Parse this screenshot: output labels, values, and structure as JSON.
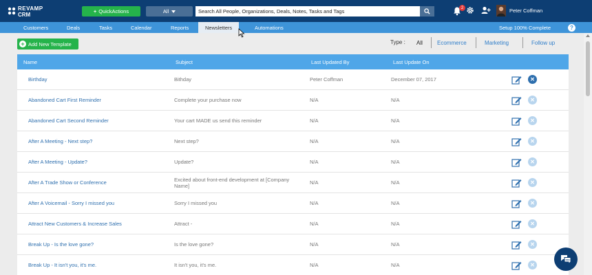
{
  "app": {
    "logo_line1": "REVAMP",
    "logo_line2": "CRM",
    "quick_actions": "QuickActions",
    "search_scope": "All",
    "search_placeholder": "Search All People, Organizations, Deals, Notes, Tasks and Tags",
    "notification_count": "2",
    "user_name": "Peter Coffman"
  },
  "nav": {
    "items": [
      "Customers",
      "Deals",
      "Tasks",
      "Calendar",
      "Reports",
      "Newsletters",
      "Automations"
    ],
    "active": "Newsletters",
    "setup": "Setup 100% Complete",
    "help": "?"
  },
  "toolbar": {
    "add_label": "Add New Template",
    "type_label": "Type :",
    "filters": [
      "All",
      "Ecommerce",
      "Marketing",
      "Follow up"
    ],
    "active_filter": "All"
  },
  "table": {
    "headers": [
      "Name",
      "Subject",
      "Last Updated By",
      "Last Update On"
    ],
    "rows": [
      {
        "name": "Birthday",
        "subject": "Bithday",
        "by": "Peter Coffman",
        "on": "December 07, 2017",
        "deletable": true
      },
      {
        "name": "Abandoned Cart First Reminder",
        "subject": "Complete your purchase now",
        "by": "N/A",
        "on": "N/A",
        "deletable": false
      },
      {
        "name": "Abandoned Cart Second Reminder",
        "subject": "Your cart MADE us send this reminder",
        "by": "N/A",
        "on": "N/A",
        "deletable": false
      },
      {
        "name": "After A Meeting - Next step?",
        "subject": "Next step?",
        "by": "N/A",
        "on": "N/A",
        "deletable": false
      },
      {
        "name": "After A Meeting - Update?",
        "subject": "Update?",
        "by": "N/A",
        "on": "N/A",
        "deletable": false
      },
      {
        "name": "After A Trade Show or Conference",
        "subject": "Excited about front-end development at [Company Name]",
        "by": "N/A",
        "on": "N/A",
        "deletable": false
      },
      {
        "name": "After A Voicemail - Sorry I missed you",
        "subject": "Sorry I missed you",
        "by": "N/A",
        "on": "N/A",
        "deletable": false
      },
      {
        "name": "Attract New Customers & Increase Sales",
        "subject": "Attract -",
        "by": "N/A",
        "on": "N/A",
        "deletable": false
      },
      {
        "name": "Break Up - Is the love gone?",
        "subject": "Is the love gone?",
        "by": "N/A",
        "on": "N/A",
        "deletable": false
      },
      {
        "name": "Break Up - It isn't you, it's me.",
        "subject": "It isn't you, it's me.",
        "by": "N/A",
        "on": "N/A",
        "deletable": false
      }
    ]
  },
  "colors": {
    "topbar": "#0d3e73",
    "navbar": "#3e94d9",
    "table_header": "#4fa6e8",
    "green": "#25b34b",
    "link": "#2e6fae"
  },
  "icons": [
    "bell-icon",
    "gear-icon",
    "add-user-icon",
    "search-icon",
    "edit-icon",
    "delete-icon",
    "chat-icon",
    "help-icon"
  ]
}
